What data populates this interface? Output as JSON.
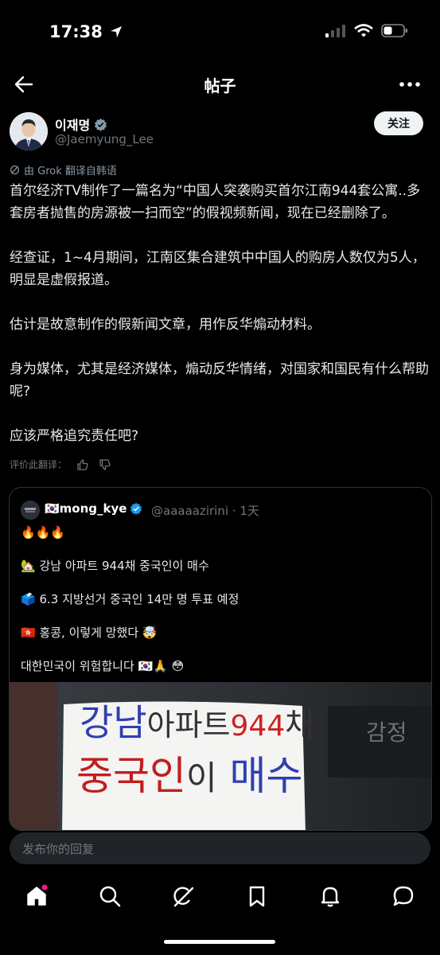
{
  "status": {
    "time": "17:38"
  },
  "header": {
    "title": "帖子"
  },
  "author": {
    "name": "이재명",
    "handle": "@Jaemyung_Lee",
    "follow_label": "关注"
  },
  "translation_note": "由 Grok 翻译自韩语",
  "post_paragraphs": [
    "首尔经济TV制作了一篇名为“中国人突袭购买首尔江南944套公寓..多套房者抛售的房源被一扫而空”的假视频新闻，现在已经删除了。",
    "经查证，1~4月期间，江南区集合建筑中中国人的购房人数仅为5人，明显是虚假报道。",
    "估计是故意制作的假新闻文章，用作反华煽动材料。",
    "身为媒体，尤其是经济媒体，煽动反华情绪，对国家和国民有什么帮助呢?",
    "应该严格追究责任吧?"
  ],
  "rate_label": "评价此翻译：",
  "quote": {
    "name": "🇰🇷mong_kye",
    "handle": "@aaaaazirini",
    "time": "· 1天",
    "lines": [
      "🔥🔥🔥",
      "🏡 강남 아파트 944채 중국인이 매수",
      "🗳️ 6.3 지방선거 중국인 14만 명 투표 예정",
      "🇭🇰 홍콩, 이렇게 망했다 🤯",
      "대한민국이 위험합니다 🇰🇷🙏 😳"
    ],
    "image_text": {
      "line1a": "강남",
      "line1b": "아파트",
      "line1c": "944",
      "line1d": "채",
      "line2a": "중국인",
      "line2b": "이",
      "line2c": "매수",
      "sign_right": "감정"
    }
  },
  "reply_placeholder": "发布你的回复",
  "colors": {
    "background": "#000000",
    "text": "#e7e9ea",
    "muted": "#71767b",
    "accent": "#1d9bf0",
    "notification_dot": "#f91880"
  },
  "icons": {
    "back": "arrow-left-icon",
    "more": "more-horizontal-icon",
    "tabs": [
      "home-icon",
      "search-icon",
      "grok-icon",
      "bookmark-icon",
      "bell-icon",
      "message-icon"
    ]
  }
}
